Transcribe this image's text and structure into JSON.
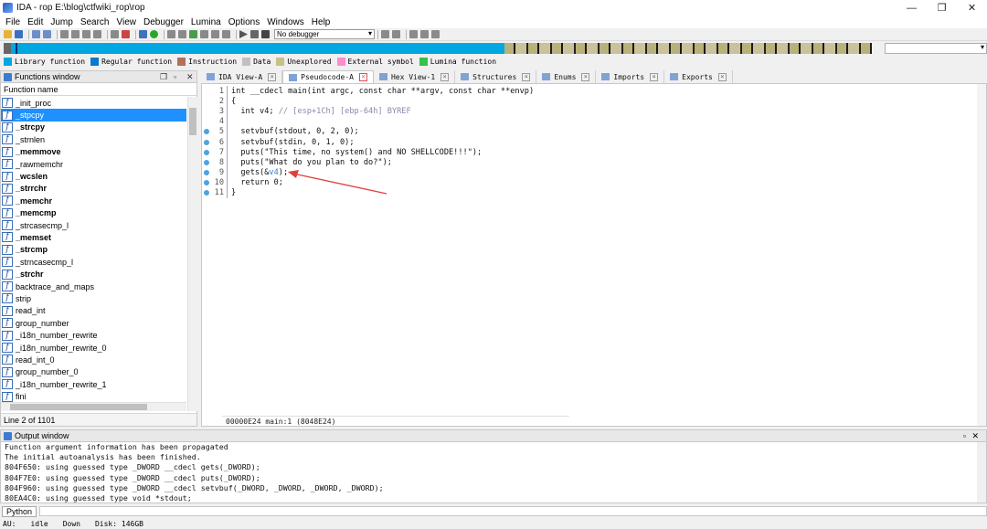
{
  "window": {
    "title": "IDA - rop E:\\blog\\ctfwiki_rop\\rop",
    "controls": [
      "—",
      "❐",
      "✕"
    ]
  },
  "menu": [
    "File",
    "Edit",
    "Jump",
    "Search",
    "View",
    "Debugger",
    "Lumina",
    "Options",
    "Windows",
    "Help"
  ],
  "toolbar": {
    "debugger_select": "No debugger"
  },
  "legend": [
    {
      "label": "Library function",
      "color": "#00a7e1"
    },
    {
      "label": "Regular function",
      "color": "#0a78d0"
    },
    {
      "label": "Instruction",
      "color": "#b0715a"
    },
    {
      "label": "Data",
      "color": "#c0c0c0"
    },
    {
      "label": "Unexplored",
      "color": "#c8c08a"
    },
    {
      "label": "External symbol",
      "color": "#ff8ad0"
    },
    {
      "label": "Lumina function",
      "color": "#33c24a"
    }
  ],
  "functions_window": {
    "title": "Functions window",
    "column": "Function name",
    "items": [
      {
        "name": "_init_proc",
        "bold": false
      },
      {
        "name": "_stpcpy",
        "bold": false,
        "selected": true
      },
      {
        "name": "_strcpy",
        "bold": true
      },
      {
        "name": "_strnlen",
        "bold": false
      },
      {
        "name": "_memmove",
        "bold": true
      },
      {
        "name": "_rawmemchr",
        "bold": false
      },
      {
        "name": "_wcslen",
        "bold": true
      },
      {
        "name": "_strrchr",
        "bold": true
      },
      {
        "name": "_memchr",
        "bold": true
      },
      {
        "name": "_memcmp",
        "bold": true
      },
      {
        "name": "_strcasecmp_l",
        "bold": false
      },
      {
        "name": "_memset",
        "bold": true
      },
      {
        "name": "_strcmp",
        "bold": true
      },
      {
        "name": "_strncasecmp_l",
        "bold": false
      },
      {
        "name": "_strchr",
        "bold": true
      },
      {
        "name": "backtrace_and_maps",
        "bold": false
      },
      {
        "name": "strip",
        "bold": false
      },
      {
        "name": "read_int",
        "bold": false
      },
      {
        "name": "group_number",
        "bold": false
      },
      {
        "name": "_i18n_number_rewrite",
        "bold": false
      },
      {
        "name": "_i18n_number_rewrite_0",
        "bold": false
      },
      {
        "name": "read_int_0",
        "bold": false
      },
      {
        "name": "group_number_0",
        "bold": false
      },
      {
        "name": "_i18n_number_rewrite_1",
        "bold": false
      },
      {
        "name": "fini",
        "bold": false
      }
    ],
    "status": "Line 2 of 1101"
  },
  "tabs": [
    {
      "label": "IDA View-A",
      "active": false
    },
    {
      "label": "Pseudocode-A",
      "active": true
    },
    {
      "label": "Hex View-1",
      "active": false
    },
    {
      "label": "Structures",
      "active": false
    },
    {
      "label": "Enums",
      "active": false
    },
    {
      "label": "Imports",
      "active": false
    },
    {
      "label": "Exports",
      "active": false
    }
  ],
  "code": {
    "lines": [
      {
        "n": "1",
        "dot": false,
        "text": "int __cdecl main(int argc, const char **argv, const char **envp)"
      },
      {
        "n": "2",
        "dot": false,
        "text": "{"
      },
      {
        "n": "3",
        "dot": false,
        "text": "  int v4; ",
        "comment": "// [esp+1Ch] [ebp-64h] BYREF"
      },
      {
        "n": "4",
        "dot": false,
        "text": ""
      },
      {
        "n": "5",
        "dot": true,
        "text": "  setvbuf(stdout, 0, 2, 0);"
      },
      {
        "n": "6",
        "dot": true,
        "text": "  setvbuf(stdin, 0, 1, 0);"
      },
      {
        "n": "7",
        "dot": true,
        "text": "  puts(\"This time, no system() and NO SHELLCODE!!!\");"
      },
      {
        "n": "8",
        "dot": true,
        "text": "  puts(\"What do you plan to do?\");"
      },
      {
        "n": "9",
        "dot": true,
        "text": "  gets(&",
        "highlight": "v4",
        "after": ");"
      },
      {
        "n": "10",
        "dot": true,
        "text": "  return 0;"
      },
      {
        "n": "11",
        "dot": true,
        "text": "}"
      }
    ],
    "status": "00000E24 main:1 (8048E24)"
  },
  "output": {
    "title": "Output window",
    "lines": [
      "Function argument information has been propagated",
      "The initial autoanalysis has been finished.",
      "804F650: using guessed type _DWORD __cdecl gets(_DWORD);",
      "804F7E0: using guessed type _DWORD __cdecl puts(_DWORD);",
      "804F960: using guessed type _DWORD __cdecl setvbuf(_DWORD, _DWORD, _DWORD, _DWORD);",
      "80EA4C0: using guessed type void *stdout;"
    ]
  },
  "python_button": "Python",
  "statusbar": {
    "au": "AU:",
    "state": "idle",
    "direction": "Down",
    "disk": "Disk: 146GB"
  }
}
